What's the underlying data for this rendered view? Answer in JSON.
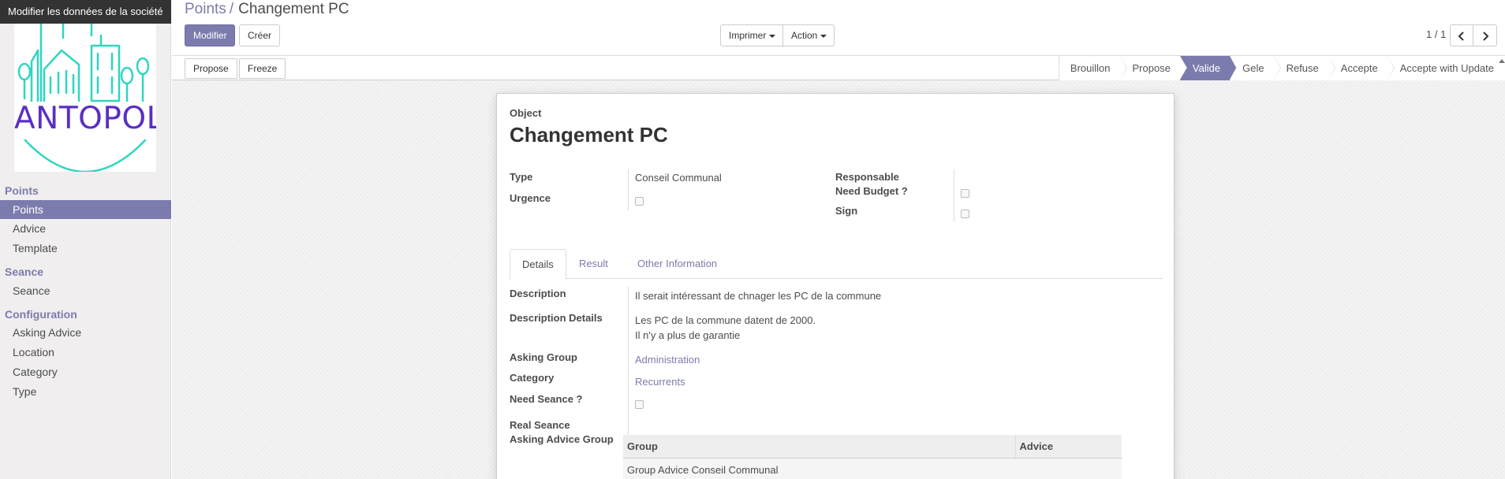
{
  "tooltip": "Modifier les données de la société",
  "logo": {
    "text": "ANTOPOLIS",
    "color_text": "#5b2ec4",
    "color_lines": "#2fd6c0"
  },
  "sidebar": {
    "sections": [
      {
        "title": "Points",
        "items": [
          "Points",
          "Advice",
          "Template"
        ]
      },
      {
        "title": "Seance",
        "items": [
          "Seance"
        ]
      },
      {
        "title": "Configuration",
        "items": [
          "Asking Advice",
          "Location",
          "Category",
          "Type"
        ]
      }
    ],
    "active_item": "Points"
  },
  "breadcrumb": {
    "parent": "Points",
    "separator": "/",
    "current": "Changement PC"
  },
  "toolbar": {
    "edit_label": "Modifier",
    "create_label": "Créer",
    "print_label": "Imprimer",
    "action_label": "Action",
    "pager": "1 / 1"
  },
  "statusbar": {
    "buttons": [
      "Propose",
      "Freeze"
    ],
    "stages": [
      "Brouillon",
      "Propose",
      "Valide",
      "Gele",
      "Refuse",
      "Accepte",
      "Accepte with Update"
    ],
    "active_stage": "Valide"
  },
  "form": {
    "object_label": "Object",
    "title": "Changement PC",
    "type_label": "Type",
    "type_value": "Conseil Communal",
    "urgence_label": "Urgence",
    "responsable_label": "Responsable",
    "need_budget_label": "Need Budget ?",
    "sign_label": "Sign",
    "tabs": [
      "Details",
      "Result",
      "Other Information"
    ],
    "active_tab": "Details",
    "description_label": "Description",
    "description_value": "Il serait intéressant de chnager les PC de la commune",
    "description_details_label": "Description Details",
    "description_details_line1": "Les PC de la commune datent de 2000.",
    "description_details_line2": "Il n'y a plus de garantie",
    "asking_group_label": "Asking Group",
    "asking_group_value": "Administration",
    "category_label": "Category",
    "category_value": "Recurrents",
    "need_seance_label": "Need Seance ?",
    "real_seance_label": "Real Seance",
    "asking_advice_group_label": "Asking Advice Group",
    "table": {
      "columns": [
        "Group",
        "Advice"
      ],
      "rows": [
        [
          "Group Advice Conseil Communal",
          ""
        ]
      ]
    }
  }
}
